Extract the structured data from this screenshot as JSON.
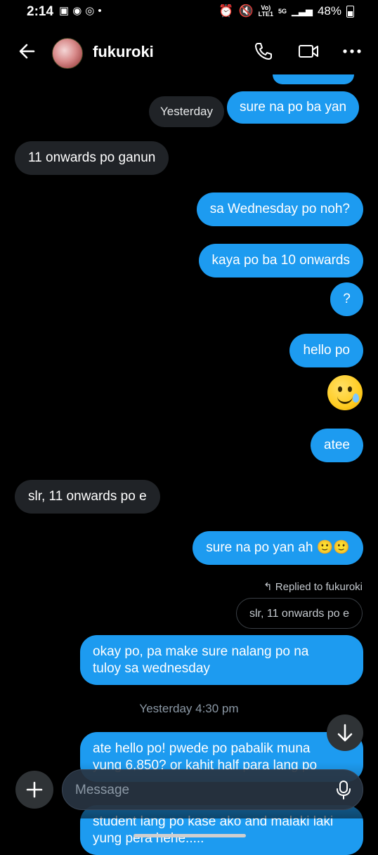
{
  "status_bar": {
    "time": "2:14",
    "left_icons": [
      "gallery-icon",
      "messenger-icon",
      "instagram-icon",
      "dot-icon"
    ],
    "network_top": "Vo)",
    "network_bottom": "LTE1",
    "net_type": "5G",
    "battery": "48%"
  },
  "header": {
    "contact_name": "fukuroki",
    "icons": [
      "back-arrow-icon",
      "phone-icon",
      "video-icon",
      "more-icon"
    ]
  },
  "messages": {
    "m1": "sure na po ba yan",
    "day_label": "Yesterday",
    "m2": "11 onwards po ganun",
    "m3": "sa Wednesday po noh?",
    "m4": "kaya po ba 10 onwards",
    "m5": "?",
    "m6": "hello po",
    "m7": "atee",
    "m8": "slr, 11 onwards po e",
    "m9": "sure na po yan ah 🙂🙂",
    "replied_label": "Replied to fukuroki",
    "quoted": "slr, 11 onwards po e",
    "m10_line1": "okay po, pa make sure nalang po na",
    "m10_line2": "tuloy sa wednesday",
    "timestamp": "Yesterday 4:30 pm",
    "m11_line1": "ate hello po! pwede po pabalik muna",
    "m11_line2": "yung 6,850? or kahit half para lang po",
    "m12_line1": "student lang po kase ako and malaki laki",
    "m12_line2": "yung pera hehe....."
  },
  "composer": {
    "placeholder": "Message"
  },
  "colors": {
    "outgoing_bubble": "#1d9bf0",
    "incoming_bubble": "#202327",
    "background": "#000000"
  }
}
